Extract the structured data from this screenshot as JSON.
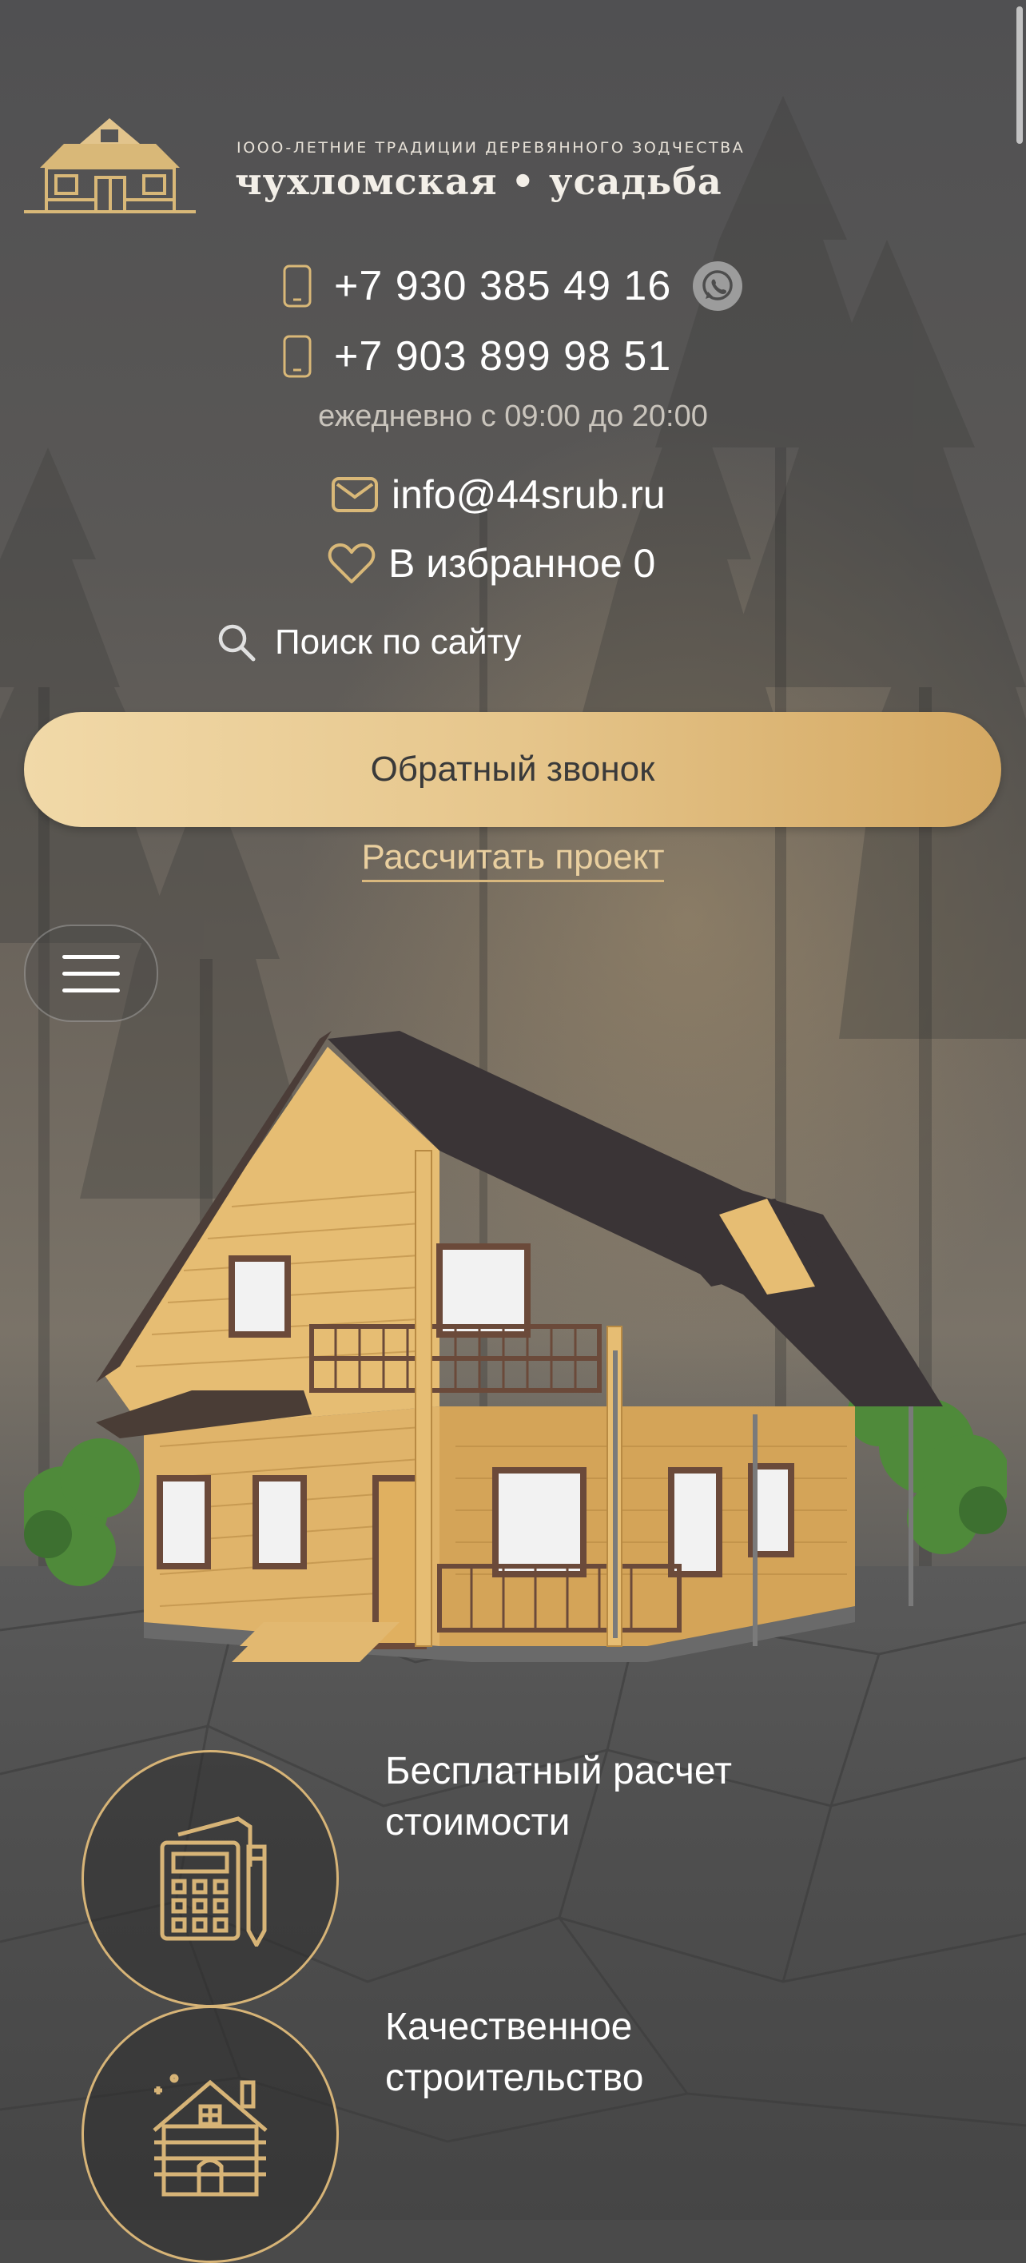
{
  "header": {
    "logo_tagline": "IOOO-ЛЕТНИЕ ТРАДИЦИИ ДЕРЕВЯННОГО ЗОДЧЕСТВА",
    "logo_name": "чухломская • усадьба"
  },
  "contacts": {
    "phone1": "+7 930 385 49 16",
    "phone2": "+7 903 899 98 51",
    "hours": "ежедневно с 09:00 до 20:00",
    "email": "info@44srub.ru",
    "favorites": "В избранное 0",
    "search": "Поиск по сайту"
  },
  "actions": {
    "callback": "Обратный звонок",
    "calculate": "Рассчитать проект"
  },
  "features": [
    {
      "title": "Бесплатный расчет стоимости",
      "icon": "calculator-icon"
    },
    {
      "title": "Качественное строительство",
      "icon": "log-house-icon"
    }
  ],
  "colors": {
    "accent": "#d7b477",
    "button_gradient_start": "#f1d9a8",
    "button_gradient_end": "#d4a862"
  }
}
